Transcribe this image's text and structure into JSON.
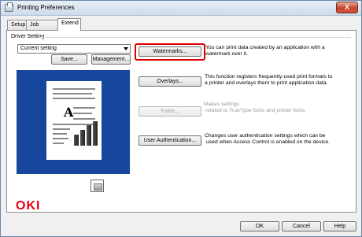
{
  "window": {
    "title": "Printing Preferences",
    "close_symbol": "X"
  },
  "tabs": [
    {
      "label": "Setup"
    },
    {
      "label": "Job Options"
    },
    {
      "label": "Extend"
    }
  ],
  "driver_setting": {
    "group_label": "Driver Setting",
    "selected": "Current setting",
    "save_label": "Save...",
    "management_label": "Management..."
  },
  "features": [
    {
      "button": "Watermarks...",
      "desc_1": "You can print data created by an application with a",
      "desc_2": "watermark over it."
    },
    {
      "button": "Overlays...",
      "desc_1": "This function registers frequently-used print formats to",
      "desc_2": "a printer and overlays them to print application data."
    },
    {
      "button": "Fonts...",
      "desc_1": "Makes settings",
      "desc_2": "related to TrueType fonts and printer fonts."
    },
    {
      "button": "User Authentication...",
      "desc_1": "Changes user authentication settings which can be",
      "desc_2": "used when Access Control is enabled on the device."
    }
  ],
  "preview": {
    "letter": "A"
  },
  "brand": {
    "logo": "OKI",
    "color": "#e60012"
  },
  "footer": {
    "ok": "OK",
    "cancel": "Cancel",
    "help": "Help"
  }
}
